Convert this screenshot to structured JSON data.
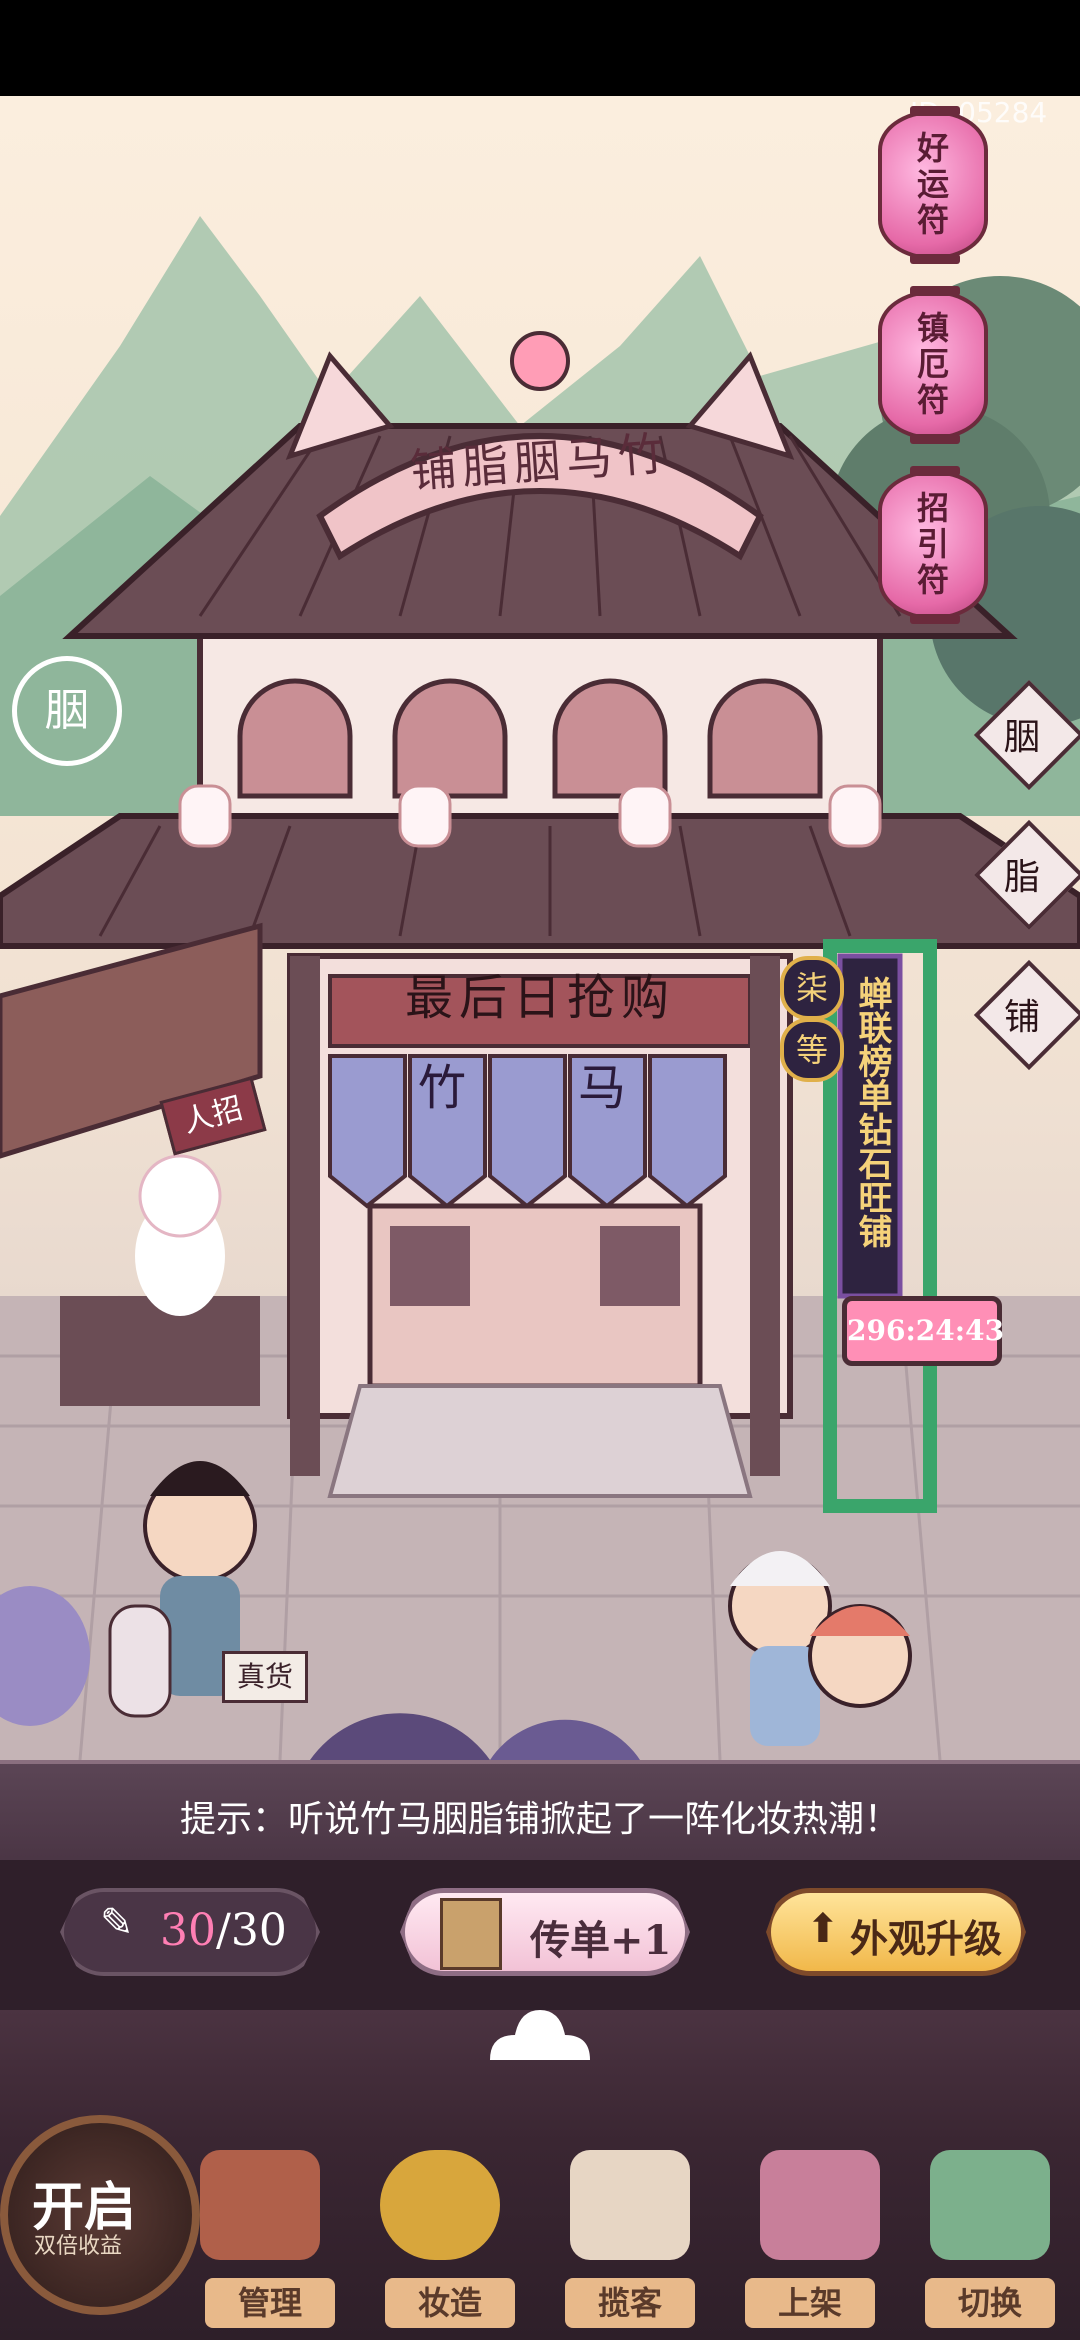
{
  "game": {
    "player_id": "ID: 05284",
    "shop_sign": "铺脂胭马竹",
    "shop_mark": "胭",
    "banner_main": "最后日抢购",
    "curtain_text": [
      "竹",
      "马"
    ],
    "recruit_sign": "人招",
    "goods_sign": "真货",
    "lanterns": [
      "好运符",
      "镇厄符",
      "招引符"
    ],
    "right_flags": [
      "胭",
      "脂",
      "铺"
    ],
    "rank_badge": [
      "柒",
      "等"
    ],
    "rank_board": "蝉联榜单钻石旺铺",
    "countdown": "296:24:43"
  },
  "hint": {
    "text": "提示：听说竹马胭脂铺掀起了一阵化妆热潮！"
  },
  "actions": {
    "counter_current": "30",
    "counter_sep": "/",
    "counter_max": "30",
    "flyer_label": "传单+1",
    "upgrade_label": "外观升级"
  },
  "bottom": {
    "open_label": "开启",
    "open_sub": "双倍收益",
    "nav": [
      "管理",
      "妆造",
      "揽客",
      "上架",
      "切换"
    ]
  },
  "colors": {
    "accent_pink": "#ff7fb4",
    "panel_bg": "#3f2a36",
    "gold": "#f1b84a",
    "lantern_pink": "#e66aa8"
  }
}
